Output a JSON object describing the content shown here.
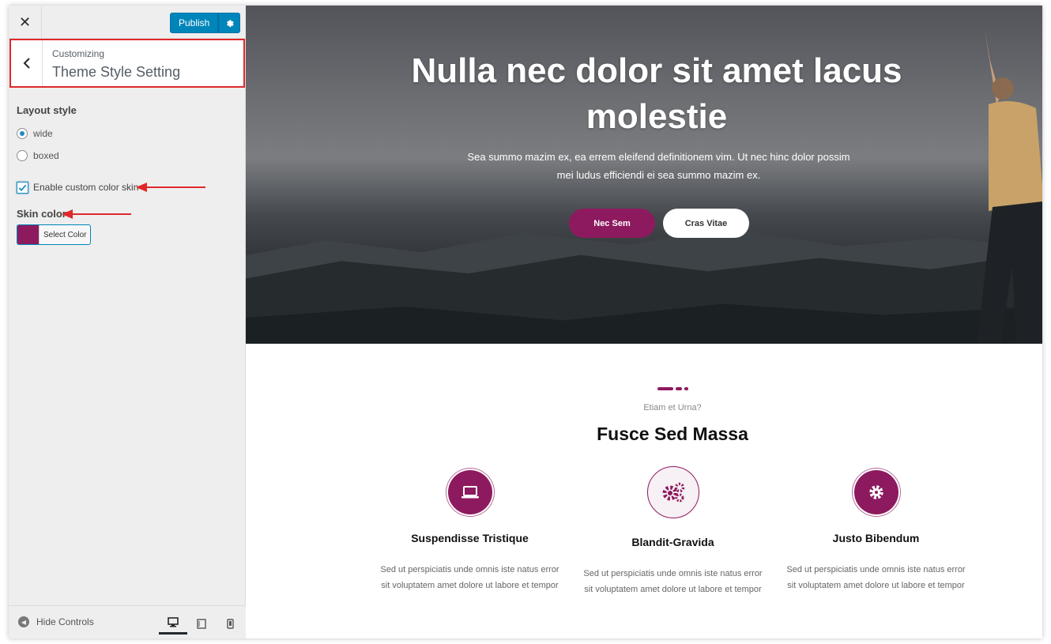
{
  "topbar": {
    "close_icon": "close-icon",
    "publish_label": "Publish",
    "settings_icon": "gear-icon"
  },
  "section": {
    "back_icon": "chevron-left-icon",
    "customizing_label": "Customizing",
    "title": "Theme Style Setting"
  },
  "controls": {
    "layout_title": "Layout style",
    "layout_options": [
      {
        "label": "wide",
        "checked": true
      },
      {
        "label": "boxed",
        "checked": false
      }
    ],
    "custom_skin_label": "Enable custom color skin",
    "custom_skin_checked": true,
    "skin_color_title": "Skin color",
    "select_color_label": "Select Color",
    "skin_color_value": "#8d1a5f"
  },
  "footer": {
    "hide_controls_label": "Hide Controls",
    "devices": [
      "desktop-icon",
      "tablet-icon",
      "mobile-icon"
    ]
  },
  "hero": {
    "title": "Nulla nec dolor sit amet lacus molestie",
    "subtitle": "Sea summo mazim ex, ea errem eleifend definitionem vim. Ut nec hinc dolor possim mei ludus efficiendi ei sea summo mazim ex.",
    "primary_button": "Nec Sem",
    "secondary_button": "Cras Vitae"
  },
  "services": {
    "eyebrow": "Etiam et Urna?",
    "heading": "Fusce Sed Massa",
    "items": [
      {
        "icon": "laptop-icon",
        "title": "Suspendisse Tristique",
        "text": "Sed ut perspiciatis unde omnis iste natus error sit voluptatem amet dolore ut labore et tempor"
      },
      {
        "icon": "gears-icon",
        "title": "Blandit-Gravida",
        "text": "Sed ut perspiciatis unde omnis iste natus error sit voluptatem amet dolore ut labore et tempor"
      },
      {
        "icon": "gear-icon",
        "title": "Justo Bibendum",
        "text": "Sed ut perspiciatis unde omnis iste natus error sit voluptatem amet dolore ut labore et tempor"
      }
    ]
  },
  "colors": {
    "accent": "#8d1a5f",
    "publish": "#0085ba",
    "highlight": "#e0272a"
  }
}
